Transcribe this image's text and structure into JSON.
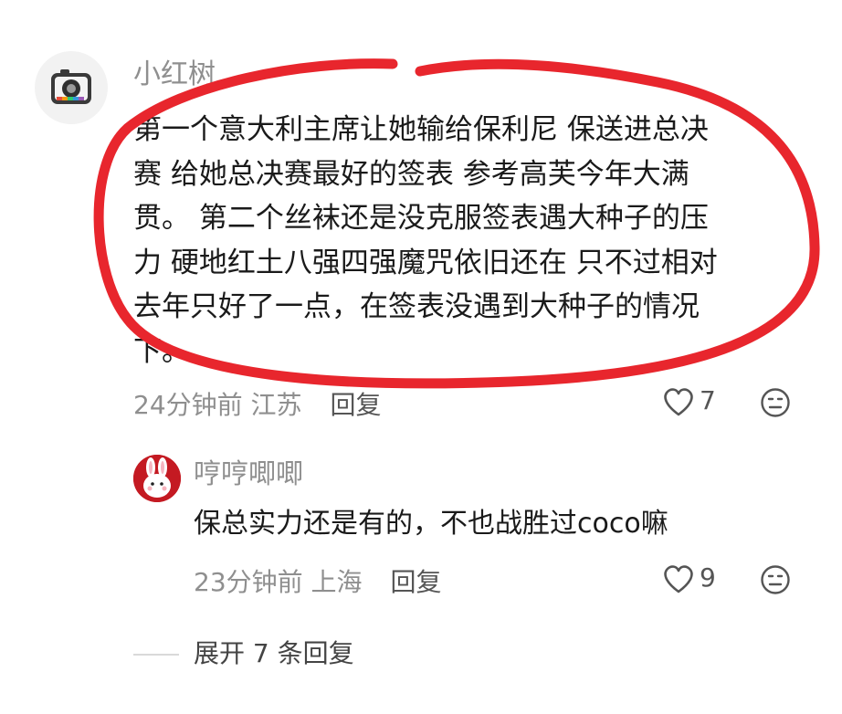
{
  "comment": {
    "username": "小红树",
    "text": "第一个意大利主席让她输给保利尼 保送进总决\n赛 给她总决赛最好的签表 参考高芙今年大满\n贯。 第二个丝袜还是没克服签表遇大种子的压\n力 硬地红土八强四强魔咒依旧还在 只不过相对\n去年只好了一点，在签表没遇到大种子的情况\n下。",
    "time": "24分钟前",
    "location": "江苏",
    "reply_label": "回复",
    "likes": "7"
  },
  "reply": {
    "username": "哼哼唧唧",
    "text": "保总实力还是有的，不也战胜过coco嘛",
    "time": "23分钟前",
    "location": "上海",
    "reply_label": "回复",
    "likes": "9"
  },
  "expand": {
    "label": "展开 7 条回复"
  },
  "colors": {
    "annotation_red": "#e8262d",
    "meta_gray": "#8f8f8f"
  },
  "icons": [
    "camera-avatar-icon",
    "heart-icon",
    "emoji-icon",
    "rabbit-avatar-icon"
  ]
}
